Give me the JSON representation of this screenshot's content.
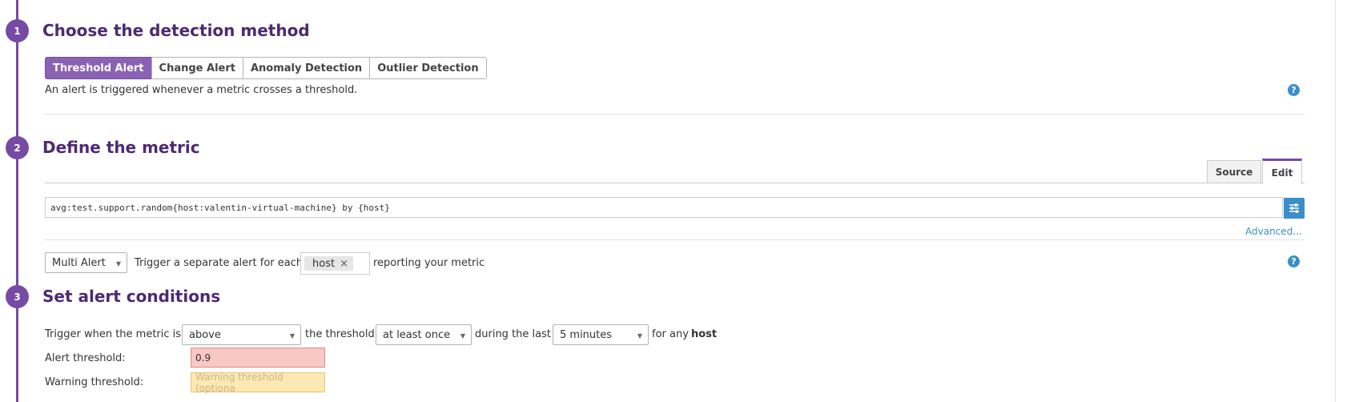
{
  "steps": [
    {
      "number": "1",
      "title": "Choose the detection method"
    },
    {
      "number": "2",
      "title": "Define the metric"
    },
    {
      "number": "3",
      "title": "Set alert conditions"
    }
  ],
  "detection": {
    "methods": [
      "Threshold Alert",
      "Change Alert",
      "Anomaly Detection",
      "Outlier Detection"
    ],
    "active": "Threshold Alert",
    "description": "An alert is triggered whenever a metric crosses a threshold.",
    "help_glyph": "?"
  },
  "metric": {
    "tabs": {
      "source": "Source",
      "edit": "Edit"
    },
    "active_tab": "Edit",
    "query": "avg:test.support.random{host:valentin-virtual-machine} by {host}",
    "advanced_link": "Advanced...",
    "alert_type": "Multi Alert",
    "trigger_prefix": "Trigger a separate alert for each",
    "group_tag": "host",
    "tag_remove": "×",
    "trigger_suffix": "reporting your metric",
    "help_glyph": "?"
  },
  "conditions": {
    "trigger_prefix": "Trigger when the metric is",
    "comparison": "above",
    "threshold_text": "the threshold",
    "frequency": "at least once",
    "during_text": "during the last",
    "window": "5 minutes",
    "for_any_text": "for any",
    "for_any_group": "host",
    "alert_label": "Alert threshold:",
    "alert_value": "0.9",
    "warning_label": "Warning threshold:",
    "warning_placeholder": "Warning threshold (optiona"
  },
  "colors": {
    "accent": "#774aa4",
    "link": "#3a8fc9",
    "alert_bg": "#f8c8c5",
    "warning_bg": "#fce8b3"
  },
  "icons": {
    "help": "question-circle-icon",
    "query_options": "sliders-icon",
    "caret": "caret-down-icon",
    "remove": "close-icon"
  }
}
